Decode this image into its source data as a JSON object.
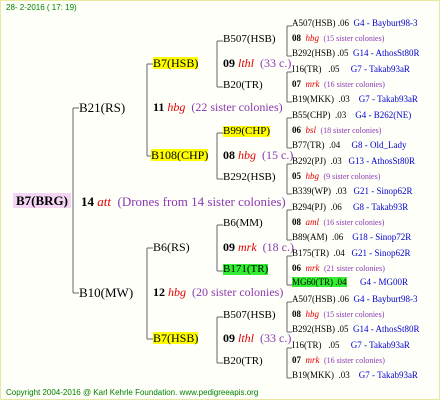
{
  "date": "28-  2-2016 ( 17: 19)",
  "footer": "Copyright 2004-2016 @ Karl Kehrle Foundation.   www.pedigreeapis.org",
  "root": {
    "label": "B7(BRG)",
    "num": "14",
    "ital": "att",
    "note": "(Drones from 14 sister colonies)"
  },
  "L1": [
    {
      "label": "B21(RS)",
      "num": "11",
      "ital": "hbg",
      "note": "(22 sister colonies)"
    },
    {
      "label": "B10(MW)",
      "num": "12",
      "ital": "hbg",
      "note": "(20 sister colonies)"
    }
  ],
  "L2": [
    {
      "label": "B7(HSB)",
      "num": "09",
      "ital": "lthl",
      "note": "(33 c.)"
    },
    {
      "label": "B108(CHP)",
      "num": "08",
      "ital": "hbg",
      "note": "(15 c.)"
    },
    {
      "label": "B6(RS)",
      "num": "09",
      "ital": "mrk",
      "note": "(18 c.)"
    },
    {
      "label": "B7(HSB)",
      "num": "09",
      "ital": "lthl",
      "note": "(33 c.)"
    }
  ],
  "L3": [
    {
      "label": "B507(HSB)",
      "num": "08",
      "ital": "hbg",
      "note": "(15 sister colonies)"
    },
    {
      "label": "B20(TR)",
      "num": "07",
      "ital": "mrk",
      "note": "(16 sister colonies)"
    },
    {
      "label": "B99(CHP)",
      "num": "06",
      "ital": "bsl",
      "note": "(18 sister colonies)"
    },
    {
      "label": "B292(HSB)",
      "num": "05",
      "ital": "hbg",
      "note": "(9 sister colonies)"
    },
    {
      "label": "B6(MM)",
      "num": "08",
      "ital": "aml",
      "note": "(16 sister colonies)"
    },
    {
      "label": "B171(TR)",
      "num": "06",
      "ital": "mrk",
      "note": "(21 sister colonies)"
    },
    {
      "label": "B507(HSB)",
      "num": "08",
      "ital": "hbg",
      "note": "(15 sister colonies)"
    },
    {
      "label": "B20(TR)",
      "num": "07",
      "ital": "mrk",
      "note": "(16 sister colonies)"
    }
  ],
  "L4": [
    {
      "label": "A507(HSB)",
      "val": ".06",
      "link": "G4 - Bayburt98-3"
    },
    {
      "label": "B292(HSB)",
      "val": ".05",
      "link": "G14 - AthosSt80R"
    },
    {
      "label": "I16(TR)",
      "val": ".05",
      "link": "G7 - Takab93aR"
    },
    {
      "label": "B19(MKK)",
      "val": ".03",
      "link": "G7 - Takab93aR"
    },
    {
      "label": "B55(CHP)",
      "val": ".03",
      "link": "G4 - B262(NE)"
    },
    {
      "label": "B77(TR)",
      "val": ".04",
      "link": "G8 - Old_Lady"
    },
    {
      "label": "B292(PJ)",
      "val": ".03",
      "link": "G13 - AthosSt80R"
    },
    {
      "label": "B339(WP)",
      "val": ".03",
      "link": "G21 - Sinop62R"
    },
    {
      "label": "B294(PJ)",
      "val": ".06",
      "link": "G8 - Takab93R"
    },
    {
      "label": "B89(AM)",
      "val": ".06",
      "link": "G18 - Sinop72R"
    },
    {
      "label": "B175(TR)",
      "val": ".04",
      "link": "G21 - Sinop62R"
    },
    {
      "label": "MG60(TR)",
      "val": ".04",
      "link": "G4 - MG00R"
    },
    {
      "label": "A507(HSB)",
      "val": ".06",
      "link": "G4 - Bayburt98-3"
    },
    {
      "label": "B292(HSB)",
      "val": ".05",
      "link": "G14 - AthosSt80R"
    },
    {
      "label": "I16(TR)",
      "val": ".05",
      "link": "G7 - Takab93aR"
    },
    {
      "label": "B19(MKK)",
      "val": ".03",
      "link": "G7 - Takab93aR"
    }
  ]
}
